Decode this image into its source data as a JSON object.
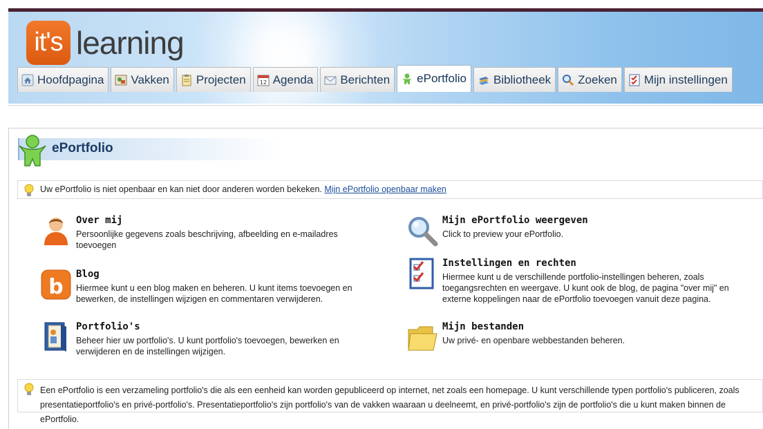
{
  "header": {
    "logo_badge": "it's",
    "logo_wordmark": "learning"
  },
  "tabs": [
    {
      "label": "Hoofdpagina",
      "icon": "home-icon"
    },
    {
      "label": "Vakken",
      "icon": "courses-icon"
    },
    {
      "label": "Projecten",
      "icon": "clipboard-icon"
    },
    {
      "label": "Agenda",
      "icon": "calendar-icon"
    },
    {
      "label": "Berichten",
      "icon": "envelope-icon"
    },
    {
      "label": "ePortfolio",
      "icon": "person-icon",
      "active": true
    },
    {
      "label": "Bibliotheek",
      "icon": "books-icon"
    },
    {
      "label": "Zoeken",
      "icon": "magnifier-icon"
    },
    {
      "label": "Mijn instellingen",
      "icon": "checklist-icon"
    }
  ],
  "page": {
    "title": "ePortfolio"
  },
  "notice": {
    "text": "Uw ePortfolio is niet openbaar en kan niet door anderen worden bekeken. ",
    "link": "Mijn ePortfolio openbaar maken"
  },
  "features": {
    "about": {
      "title": "Over mij",
      "desc": "Persoonlijke gegevens zoals beschrijving, afbeelding en e-mailadres toevoegen",
      "icon": "user-avatar-icon"
    },
    "blog": {
      "title": "Blog",
      "desc": "Hiermee kunt u een blog maken en beheren. U kunt items toevoegen en bewerken, de instellingen wijzigen en commentaren verwijderen.",
      "icon": "blog-icon"
    },
    "portfolios": {
      "title": "Portfolio's",
      "desc": "Beheer hier uw portfolio's. U kunt portfolio's toevoegen, bewerken en verwijderen en de instellingen wijzigen.",
      "icon": "portfolio-binder-icon"
    },
    "view": {
      "title": "Mijn ePortfolio weergeven",
      "desc": "Click to preview your ePortfolio.",
      "icon": "magnifier-icon"
    },
    "settings": {
      "title": "Instellingen en rechten",
      "desc": "Hiermee kunt u de verschillende portfolio-instellingen beheren, zoals toegangsrechten en weergave. U kunt ook de blog, de pagina \"over mij\" en externe koppelingen naar de ePortfolio toevoegen vanuit deze pagina.",
      "icon": "checklist-icon"
    },
    "files": {
      "title": "Mijn bestanden",
      "desc": "Uw privé- en openbare webbestanden beheren.",
      "icon": "folder-icon"
    }
  },
  "footer_info": {
    "text": "Een ePortfolio is een verzameling portfolio's die als een eenheid kan worden gepubliceerd op internet, net zoals een homepage. U kunt verschillende typen portfolio's publiceren, zoals presentatieportfolio's en privé-portfolio's. Presentatieportfolio's zijn portfolio's van de vakken waaraan u deelneemt, en privé-portfolio's zijn de portfolio's die u kunt maken binnen de ePortfolio."
  },
  "colors": {
    "brand_orange": "#e8661c",
    "tab_text": "#1d3a5c",
    "link": "#1a4d9b"
  }
}
